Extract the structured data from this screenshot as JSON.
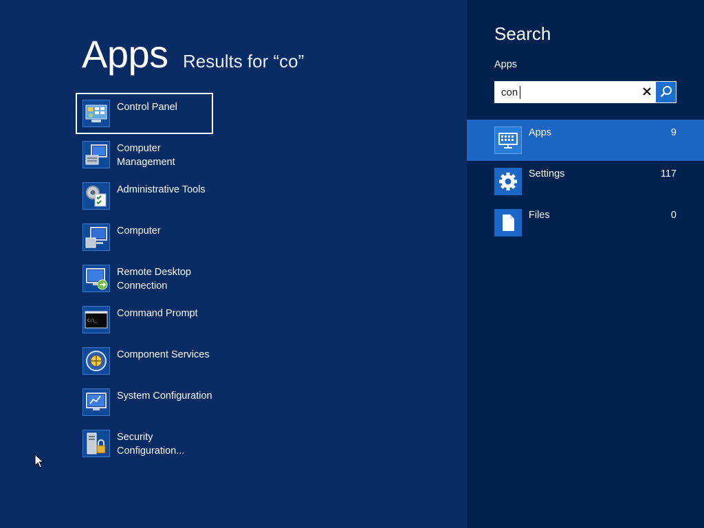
{
  "results": {
    "title": "Apps",
    "subtitle": "Results for “co”",
    "apps": [
      {
        "label": "Control Panel",
        "icon": "control-panel-icon"
      },
      {
        "label": "Computer Management",
        "icon": "computer-management-icon"
      },
      {
        "label": "Administrative Tools",
        "icon": "administrative-tools-icon"
      },
      {
        "label": "Computer",
        "icon": "computer-icon"
      },
      {
        "label": "Remote Desktop Connection",
        "icon": "remote-desktop-icon"
      },
      {
        "label": "Command Prompt",
        "icon": "command-prompt-icon"
      },
      {
        "label": "Component Services",
        "icon": "component-services-icon"
      },
      {
        "label": "System Configuration",
        "icon": "system-configuration-icon"
      },
      {
        "label": "Security Configuration...",
        "icon": "security-configuration-icon"
      }
    ]
  },
  "search": {
    "title": "Search",
    "scope": "Apps",
    "query": "con"
  },
  "categories": [
    {
      "label": "Apps",
      "count": "9",
      "icon": "apps-keyboard-icon",
      "active": true
    },
    {
      "label": "Settings",
      "count": "117",
      "icon": "gear-icon",
      "active": false
    },
    {
      "label": "Files",
      "count": "0",
      "icon": "document-icon",
      "active": false
    }
  ],
  "colors": {
    "background": "#082b63",
    "charm_background": "#01214f",
    "accent": "#1d65c2"
  }
}
